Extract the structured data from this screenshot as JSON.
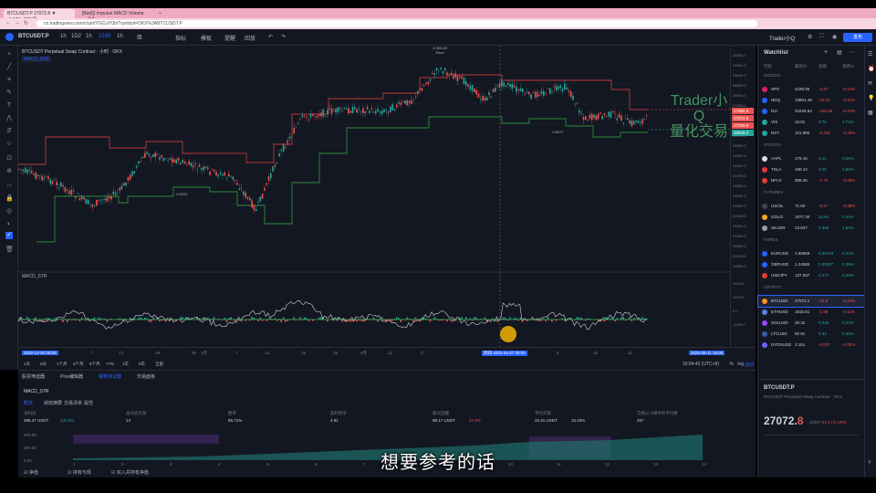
{
  "browser": {
    "tabs": [
      "BTCUSDT.P 27072.8 ▼ -0.12% 无标题",
      "[Bar]Q Impulse MACD Volume — Ind...",
      "",
      ""
    ],
    "url": "cn.tradingview.com/chart/YGCuYfJb/?symbol=OKX%3ABTCUSDT.P"
  },
  "toolbar": {
    "symbol": "BTCUSDT.P",
    "interval": "1h",
    "items": [
      "1h",
      "1D2",
      "1h",
      "1240",
      "1h",
      "指标",
      "模板",
      "提醒",
      "回放"
    ],
    "publish": "发布",
    "user": "Trader小Q"
  },
  "chart": {
    "title": "BTCUSDT Perpetual Swap Contract · 小时 · OKX",
    "indicator": "MACD_STR",
    "macd_label": "MACD_STR",
    "top_label_price": "4,359.83",
    "top_label_short": "Short",
    "marker1_price": "-0.6332",
    "marker2_price": "-4.9089",
    "marker3_price": "-0.6577",
    "price_ticks": [
      "30000.0",
      "29500.0",
      "29000.0",
      "28500.0",
      "28000.0",
      "27500.0",
      "27000.0",
      "26500.0",
      "26000.0",
      "25500.0",
      "25000.0",
      "24500.0",
      "24000.0",
      "23500.0",
      "23000.0",
      "22500.0",
      "22000.0",
      "21500.0",
      "21000.0",
      "20500.0",
      "20000.0",
      "19500.0"
    ],
    "price_tags": [
      {
        "text": "27980.5",
        "color": "#ef5350"
      },
      {
        "text": "27072.8",
        "color": "#ef5350"
      },
      {
        "text": "27009.0",
        "color": "#ef5350"
      },
      {
        "text": "26828.0",
        "color": "#26a69a"
      }
    ],
    "macd_ticks": [
      "2000.0",
      "1000.0",
      "0.0",
      "-1000.0"
    ],
    "time_ticks": [
      "2022-12-30 00:00",
      "7",
      "13",
      "19",
      "26",
      "1月",
      "7",
      "13",
      "19",
      "26",
      "4月",
      "13",
      "17",
      "周四 2022-04-27 00:00",
      "8",
      "15",
      "21",
      "2022-05-11 16:00"
    ],
    "ranges": [
      "1天",
      "5天",
      "1个月",
      "3个月",
      "6个月",
      "YTD",
      "1年",
      "5年",
      "全部"
    ],
    "clock": "16:04:43 (UTC+8)",
    "scale": [
      "%",
      "log",
      "自动"
    ]
  },
  "bottom": {
    "tabs": [
      "股票筛选器",
      "Pine编辑器",
      "策略测试器",
      "交易面板"
    ],
    "strategy": "MACD_STR",
    "subtabs": [
      "概览",
      "绩效摘要",
      "交易清单",
      "属性"
    ],
    "stats": [
      {
        "label": "净利润",
        "value": "295.37 USDT",
        "sub": "142.5%",
        "cls": "up"
      },
      {
        "label": "总闭合交易",
        "value": "14",
        "sub": "",
        "cls": ""
      },
      {
        "label": "胜率",
        "value": "85.71%",
        "sub": "",
        "cls": ""
      },
      {
        "label": "盈利因子",
        "value": "4.81",
        "sub": "",
        "cls": ""
      },
      {
        "label": "最大回撤",
        "value": "98.17 USDT",
        "sub": "27.2%",
        "cls": "dn"
      },
      {
        "label": "平均交易",
        "value": "34.31 USDT",
        "sub": "10.18%",
        "cls": ""
      },
      {
        "label": "交易以 K线中的平均数",
        "value": "257",
        "sub": "",
        "cls": ""
      }
    ],
    "equity_ticks": [
      "400.00",
      "200.00",
      "0.00"
    ],
    "x_ticks": [
      "1",
      "2",
      "3",
      "4",
      "5",
      "6",
      "7",
      "8",
      "9",
      "10",
      "11",
      "12",
      "13",
      "14"
    ],
    "checkboxes": [
      "净值",
      "持有与现",
      "买入并持有净值"
    ]
  },
  "watchlist": {
    "title": "Watchlist",
    "cols": [
      "代码",
      "最新价",
      "涨跌",
      "涨跌%"
    ],
    "sections": [
      {
        "name": "INDICES",
        "rows": [
          {
            "sym": "SPX",
            "last": "4195.95",
            "chg": "-4.27",
            "pct": "-0.14%",
            "dot": "#e91e63",
            "cls": "dn"
          },
          {
            "sym": "NDQ",
            "last": "13801.49",
            "chg": "-15.31",
            "pct": "-0.11%",
            "dot": "#2962ff",
            "cls": "dn"
          },
          {
            "sym": "DJI",
            "last": "33426.64",
            "chg": "-104.28",
            "pct": "-0.31%",
            "dot": "#2962ff",
            "cls": "dn"
          },
          {
            "sym": "VIX",
            "last": "16.81",
            "chg": "0.76",
            "pct": "4.74%",
            "dot": "#26a69a",
            "cls": "up"
          },
          {
            "sym": "DXY",
            "last": "101.992",
            "chg": "-0.329",
            "pct": "-0.32%",
            "dot": "#26a69a",
            "cls": "dn"
          }
        ]
      },
      {
        "name": "STOCKS",
        "rows": [
          {
            "sym": "AAPL",
            "last": "175.16",
            "chg": "0.11",
            "pct": "0.06%",
            "dot": "#dddddd",
            "cls": "up"
          },
          {
            "sym": "TSLA",
            "last": "180.14",
            "chg": "3.28",
            "pct": "1.86%",
            "dot": "#e53935",
            "cls": "up"
          },
          {
            "sym": "NFLX",
            "last": "365.36",
            "chg": "-1.76",
            "pct": "-0.48%",
            "dot": "#e53935",
            "cls": "dn"
          }
        ]
      },
      {
        "name": "FUTURES",
        "rows": [
          {
            "sym": "USOIL",
            "last": "71.83",
            "chg": "-0.27",
            "pct": "-0.38%",
            "dot": "#444",
            "cls": "dn"
          },
          {
            "sym": "GOLD",
            "last": "1977.30",
            "chg": "10.64",
            "pct": "0.54%",
            "dot": "#f9a825",
            "cls": "up"
          },
          {
            "sym": "SILVER",
            "last": "23.847",
            "chg": "0.358",
            "pct": "1.53%",
            "dot": "#9e9e9e",
            "cls": "up"
          }
        ]
      },
      {
        "name": "FOREX",
        "rows": [
          {
            "sym": "EURUSD",
            "last": "1.08659",
            "chg": "0.00218",
            "pct": "0.20%",
            "dot": "#2962ff",
            "cls": "up"
          },
          {
            "sym": "GBPUSD",
            "last": "1.24585",
            "chg": "0.00307",
            "pct": "0.25%",
            "dot": "#2962ff",
            "cls": "up"
          },
          {
            "sym": "USDJPY",
            "last": "137.597",
            "chg": "0.277",
            "pct": "0.20%",
            "dot": "#e53935",
            "cls": "up"
          }
        ]
      },
      {
        "name": "CRYPTO",
        "rows": [
          {
            "sym": "BTCUSD",
            "last": "27072.1",
            "chg": "-32.9",
            "pct": "-0.12%",
            "dot": "#f7931a",
            "cls": "dn"
          },
          {
            "sym": "ETHUSD",
            "last": "1815.61",
            "chg": "-1.98",
            "pct": "-0.11%",
            "dot": "#627eea",
            "cls": "dn"
          },
          {
            "sym": "SOLUSD",
            "last": "20.32",
            "chg": "0.046",
            "pct": "0.23%",
            "dot": "#9945ff",
            "cls": "up"
          },
          {
            "sym": "LTCUSD",
            "last": "92.91",
            "chg": "0.33",
            "pct": "0.36%",
            "dot": "#345d9d",
            "cls": "up"
          },
          {
            "sym": "DYDXUSD",
            "last": "2.151",
            "chg": "-0.007",
            "pct": "-0.32%",
            "dot": "#6966ff",
            "cls": "dn"
          }
        ]
      }
    ],
    "detail": {
      "sym": "BTCUSDT.P",
      "name": "BTCUSDT Perpetual Swap Contract · OKX",
      "price": "27072.",
      "price_tail": "8",
      "unit": "USDT",
      "change": "-31.4 (-0.12%)"
    }
  },
  "watermark": {
    "line1": "Trader小Q",
    "line2": "量化交易"
  },
  "subtitle": "想要参考的话",
  "colors": {
    "bg": "#131722",
    "up": "#26a69a",
    "down": "#ef5350",
    "channel_red": "#b83a3a",
    "channel_green": "#2e8b3a"
  }
}
